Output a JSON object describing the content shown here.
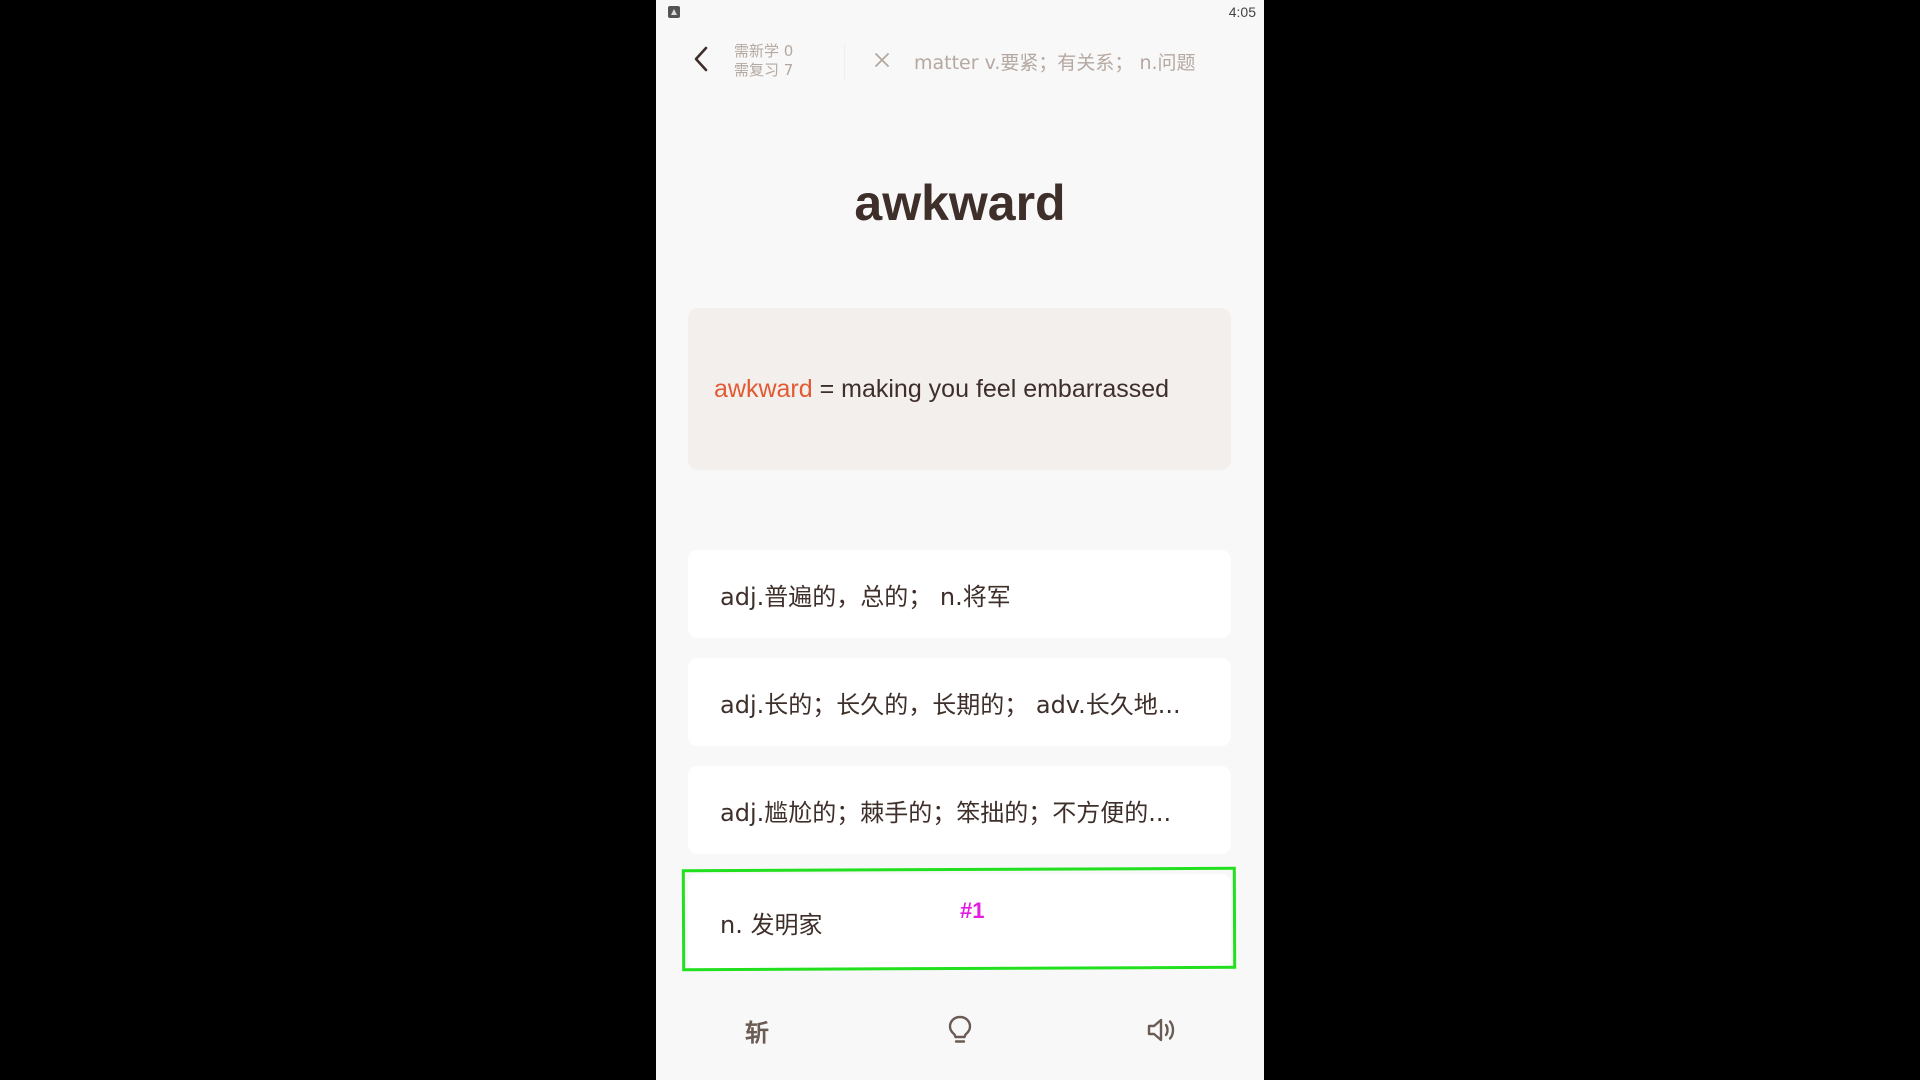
{
  "status_bar": {
    "time": "4:05"
  },
  "header": {
    "new_count_label": "需新学 0",
    "review_count_label": "需复习 7",
    "previous_word": "matter v.要紧；有关系； n.问题"
  },
  "word": "awkward",
  "example": {
    "highlight": "awkward",
    "definition": " = making you feel embarrassed"
  },
  "options": [
    "adj.普遍的，总的； n.将军",
    "adj.长的；长久的，长期的； adv.长久地...",
    "adj.尴尬的；棘手的；笨拙的；不方便的...",
    "n. 发明家"
  ],
  "annotation": {
    "tag": "#1",
    "color": "#22e01e"
  },
  "bottom_bar": {
    "slash_label": "斩"
  },
  "icons": [
    "back-arrow-icon",
    "close-icon",
    "lightbulb-icon",
    "speaker-icon"
  ],
  "colors": {
    "accent": "#e25a32",
    "text": "#3e2f2a",
    "muted": "#b5a8a0",
    "card": "#f3efed"
  }
}
